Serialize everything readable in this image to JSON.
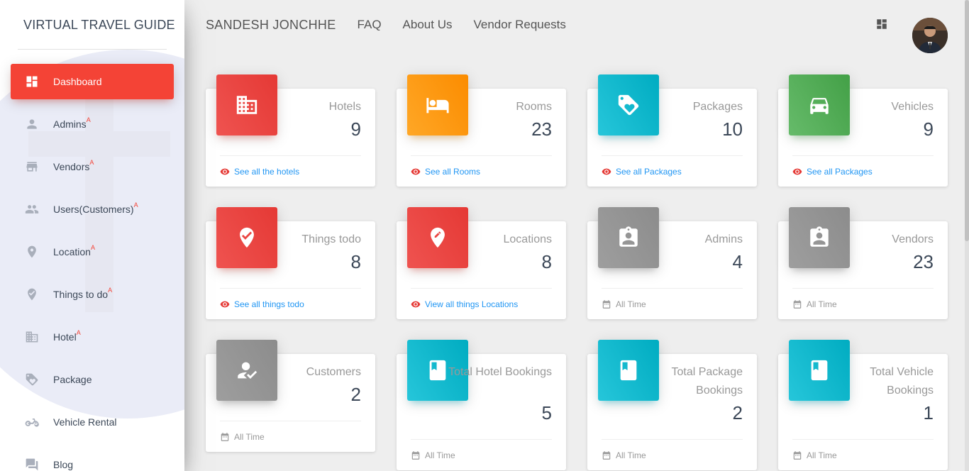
{
  "sidebar": {
    "brand": "VIRTUAL TRAVEL GUIDE",
    "items": [
      {
        "label": "Dashboard",
        "sup": "",
        "icon": "dashboard-icon",
        "active": true
      },
      {
        "label": "Admins",
        "sup": "A",
        "icon": "person-icon"
      },
      {
        "label": "Vendors",
        "sup": "A",
        "icon": "store-icon"
      },
      {
        "label": "Users(Customers)",
        "sup": "A",
        "icon": "people-icon"
      },
      {
        "label": "Location",
        "sup": "A",
        "icon": "location-pin-icon"
      },
      {
        "label": "Things to do",
        "sup": "A",
        "icon": "verified-pin-icon"
      },
      {
        "label": "Hotel",
        "sup": "A",
        "icon": "building-icon"
      },
      {
        "label": "Package",
        "sup": "",
        "icon": "tag-heart-icon"
      },
      {
        "label": "Vehicle Rental",
        "sup": "",
        "icon": "motorcycle-icon"
      },
      {
        "label": "Blog",
        "sup": "",
        "icon": "chat-icon"
      }
    ]
  },
  "header": {
    "title": "SANDESH JONCHHE",
    "links": [
      "FAQ",
      "About Us",
      "Vendor Requests"
    ]
  },
  "cards": [
    {
      "category": "Hotels",
      "value": "9",
      "footer": "See all the hotels",
      "footer_type": "link",
      "color": "#e53935",
      "icon": "building-icon"
    },
    {
      "category": "Rooms",
      "value": "23",
      "footer": "See all Rooms",
      "footer_type": "link",
      "color": "#fb8c00",
      "icon": "bed-icon"
    },
    {
      "category": "Packages",
      "value": "10",
      "footer": "See all Packages",
      "footer_type": "link",
      "color": "#00acc1",
      "icon": "tag-heart-icon"
    },
    {
      "category": "Vehicles",
      "value": "9",
      "footer": "See all Packages",
      "footer_type": "link",
      "color": "#43a047",
      "icon": "car-icon"
    },
    {
      "category": "Things todo",
      "value": "8",
      "footer": "See all things todo",
      "footer_type": "link",
      "color": "#e53935",
      "icon": "verified-pin-icon"
    },
    {
      "category": "Locations",
      "value": "8",
      "footer": "View all things Locations",
      "footer_type": "link",
      "color": "#e53935",
      "icon": "edit-location-icon"
    },
    {
      "category": "Admins",
      "value": "4",
      "footer": "All Time",
      "footer_type": "text",
      "color": "#9e9e9e",
      "icon": "badge-icon"
    },
    {
      "category": "Vendors",
      "value": "23",
      "footer": "All Time",
      "footer_type": "text",
      "color": "#9e9e9e",
      "icon": "badge-icon"
    },
    {
      "category": "Customers",
      "value": "2",
      "footer": "All Time",
      "footer_type": "text",
      "color": "#9e9e9e",
      "icon": "how-to-reg-icon"
    },
    {
      "category": "Total Hotel Bookings",
      "value": "5",
      "footer": "All Time",
      "footer_type": "text",
      "color": "#00acc1",
      "icon": "book-icon"
    },
    {
      "category": "Total Package Bookings",
      "value": "2",
      "footer": "All Time",
      "footer_type": "text",
      "color": "#00acc1",
      "icon": "book-icon"
    },
    {
      "category": "Total Vehicle Bookings",
      "value": "1",
      "footer": "All Time",
      "footer_type": "text",
      "color": "#00acc1",
      "icon": "book-icon"
    }
  ]
}
